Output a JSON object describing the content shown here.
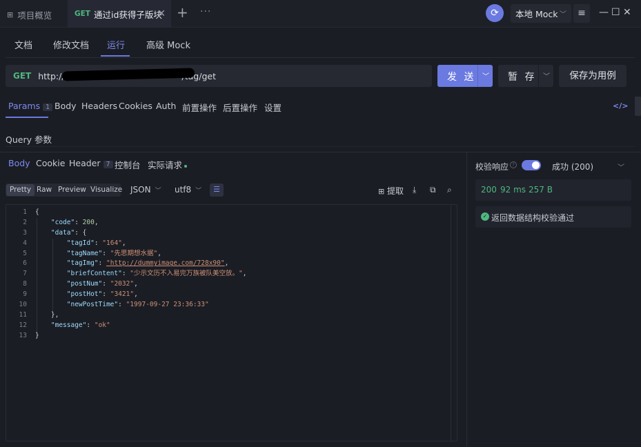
{
  "titlebar": {
    "overview_label": "项目概览",
    "tab_method": "GET",
    "tab_title": "通过id获得子版块",
    "env_label": "本地 Mock"
  },
  "subtabs": [
    "文档",
    "修改文档",
    "运行",
    "高级 Mock"
  ],
  "request": {
    "method": "GET",
    "url": "http://127.0.0.1:4523/mock/1038554-0-default/tag/get",
    "url_visible_prefix": "http://",
    "url_visible_suffix": "/tag/get",
    "send_label": "发 送",
    "save_label": "暂 存",
    "save_as_label": "保存为用例"
  },
  "param_tabs": [
    {
      "label": "Params",
      "badge": "1"
    },
    {
      "label": "Body"
    },
    {
      "label": "Headers"
    },
    {
      "label": "Cookies"
    },
    {
      "label": "Auth"
    },
    {
      "label": "前置操作"
    },
    {
      "label": "后置操作"
    },
    {
      "label": "设置"
    }
  ],
  "query_label": "Query 参数",
  "response_tabs": [
    {
      "label": "Body"
    },
    {
      "label": "Cookie"
    },
    {
      "label": "Header",
      "badge": "7"
    },
    {
      "label": "控制台"
    },
    {
      "label": "实际请求"
    }
  ],
  "format_options": [
    "Pretty",
    "Raw",
    "Preview",
    "Visualize"
  ],
  "format_selected": "Pretty",
  "content_type": "JSON",
  "encoding": "utf8",
  "extract_label": "提取",
  "code_lines": [
    "1",
    "2",
    "3",
    "4",
    "5",
    "6",
    "7",
    "8",
    "9",
    "10",
    "11",
    "12",
    "13"
  ],
  "response_json": {
    "code": 200,
    "tagId": "164",
    "tagName": "先思期想水据",
    "tagImg": "http://dummyimage.com/728x90",
    "briefContent": "少示文历不入易完万族被队美空放。",
    "postNum": "2032",
    "postHot": "3421",
    "newPostTime": "1997-09-27 23:36:33",
    "message": "ok"
  },
  "validation": {
    "label": "校验响应",
    "enabled": true,
    "status_select": "成功 (200)",
    "status_code": "200",
    "time": "92 ms",
    "size": "257 B",
    "result": "返回数据结构校验通过"
  },
  "colors": {
    "accent": "#6b7ae0",
    "success": "#4fb780",
    "background": "#1b1d24"
  }
}
